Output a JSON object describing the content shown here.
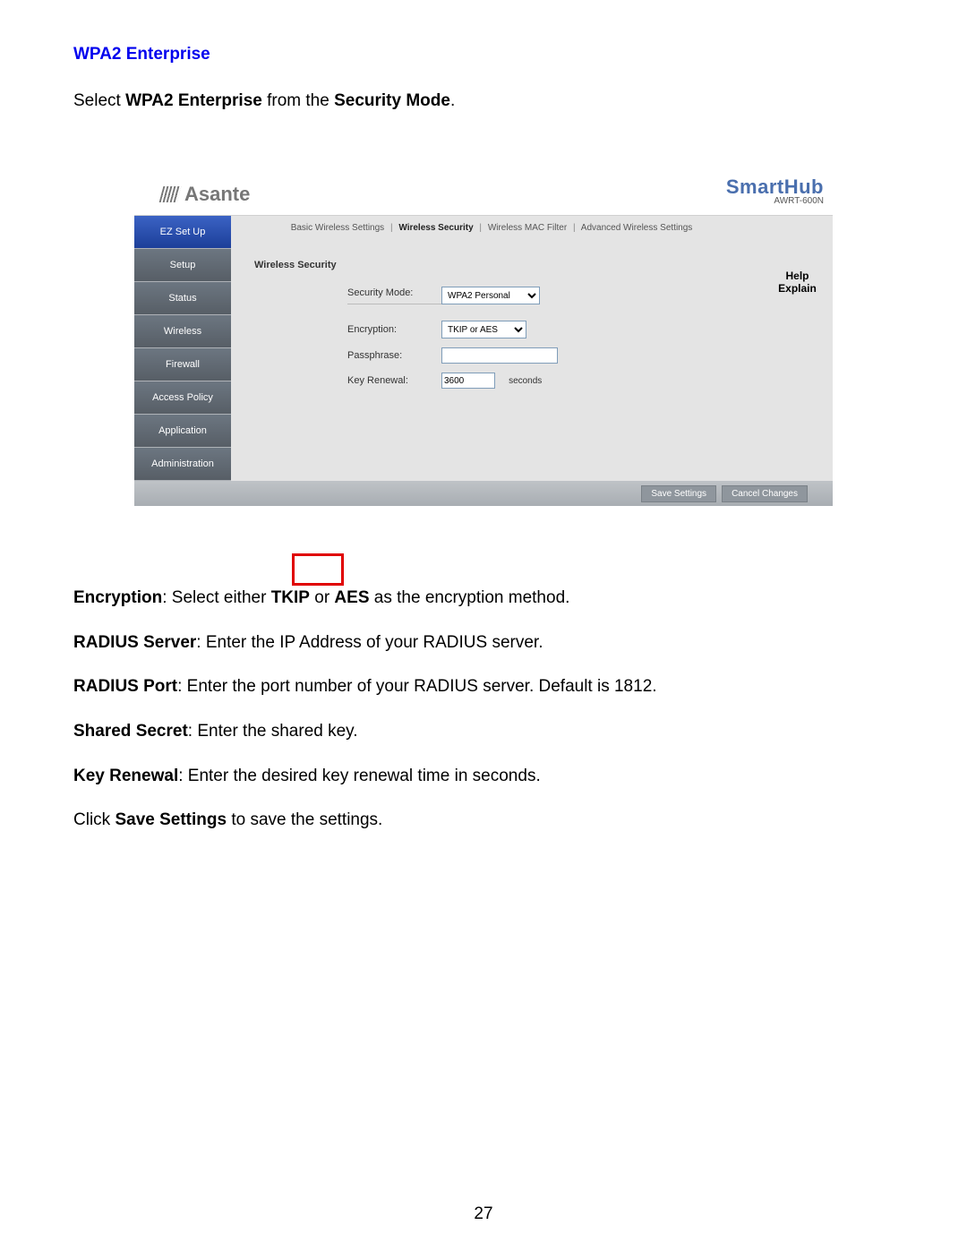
{
  "heading": "WPA2 Enterprise",
  "intro_prefix": "Select ",
  "intro_bold1": "WPA2 Enterprise",
  "intro_mid": " from the ",
  "intro_bold2": "Security Mode",
  "intro_suffix": ".",
  "logo_text": "Asante",
  "brand_big": "SmartHub",
  "brand_small": "AWRT-600N",
  "sidebar": {
    "items": [
      "EZ Set Up",
      "Setup",
      "Status",
      "Wireless",
      "Firewall",
      "Access Policy",
      "Application",
      "Administration"
    ]
  },
  "subnav": {
    "items": [
      "Basic Wireless Settings",
      "Wireless Security",
      "Wireless MAC Filter",
      "Advanced Wireless Settings"
    ],
    "active_index": 1
  },
  "help1": "Help",
  "help2": "Explain",
  "panel_title": "Wireless Security",
  "labels": {
    "security_mode": "Security Mode:",
    "encryption": "Encryption:",
    "passphrase": "Passphrase:",
    "key_renewal": "Key Renewal:"
  },
  "values": {
    "security_mode": "WPA2 Personal",
    "encryption": "TKIP or AES",
    "passphrase": "",
    "key_renewal": "3600",
    "key_renewal_unit": "seconds"
  },
  "buttons": {
    "save": "Save Settings",
    "cancel": "Cancel Changes"
  },
  "para1": {
    "b1": "Encryption",
    "t1": ": Select either ",
    "b2": "TKIP",
    "t2": " or ",
    "b3": "AES",
    "t3": " as the encryption method."
  },
  "para2": {
    "b1": "RADIUS Server",
    "t1": ": Enter the IP Address of your RADIUS server."
  },
  "para3": {
    "b1": "RADIUS Port",
    "t1": ": Enter the port number of your RADIUS server. Default is 1812."
  },
  "para4": {
    "b1": "Shared Secret",
    "t1": ": Enter the shared key."
  },
  "para5": {
    "b1": "Key Renewal",
    "t1": ": Enter the desired key renewal time in seconds."
  },
  "para6": {
    "t1": "Click ",
    "b1": "Save Settings",
    "t2": " to save the settings."
  },
  "page_number": "27"
}
